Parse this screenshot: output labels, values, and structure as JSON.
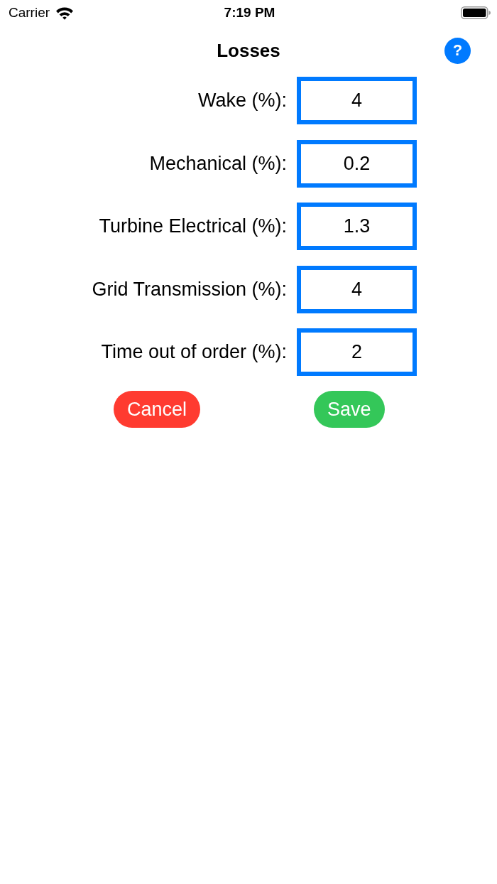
{
  "status_bar": {
    "carrier": "Carrier",
    "time": "7:19 PM"
  },
  "header": {
    "title": "Losses",
    "help_button": "?"
  },
  "fields": [
    {
      "label": "Wake (%):",
      "value": "4"
    },
    {
      "label": "Mechanical (%):",
      "value": "0.2"
    },
    {
      "label": "Turbine Electrical (%):",
      "value": "1.3"
    },
    {
      "label": "Grid Transmission (%):",
      "value": "4"
    },
    {
      "label": "Time out of order (%):",
      "value": "2"
    }
  ],
  "buttons": [
    {
      "kind": "cancel",
      "label": "Cancel"
    },
    {
      "kind": "save",
      "label": "Save"
    }
  ]
}
